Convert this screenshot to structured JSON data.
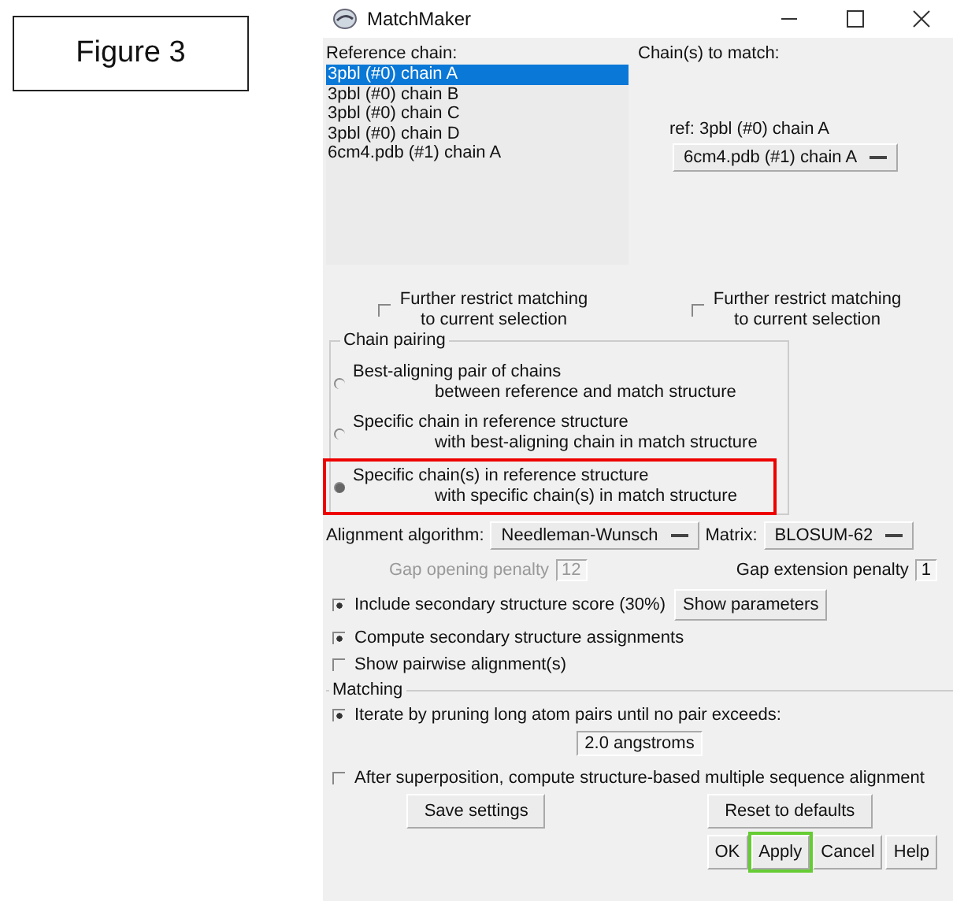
{
  "figure_label": "Figure 3",
  "window": {
    "title": "MatchMaker"
  },
  "reference_chain": {
    "label": "Reference chain:",
    "items": [
      {
        "text": "3pbl (#0) chain A",
        "selected": true
      },
      {
        "text": "3pbl (#0) chain B",
        "selected": false
      },
      {
        "text": "3pbl (#0) chain C",
        "selected": false
      },
      {
        "text": "3pbl (#0) chain D",
        "selected": false
      },
      {
        "text": "6cm4.pdb (#1) chain A",
        "selected": false
      }
    ]
  },
  "chains_to_match": {
    "label": "Chain(s) to match:",
    "ref_label": "ref: 3pbl (#0) chain A",
    "menu_value": "6cm4.pdb (#1) chain A"
  },
  "restrict": [
    {
      "lines": [
        "Further restrict matching",
        "to current selection"
      ],
      "checked": false
    },
    {
      "lines": [
        "Further restrict matching",
        "to current selection"
      ],
      "checked": false
    }
  ],
  "chain_pairing": {
    "title": "Chain pairing",
    "options": [
      {
        "lines": [
          "Best-aligning pair of chains",
          "between reference and match structure"
        ],
        "selected": false,
        "highlighted": false
      },
      {
        "lines": [
          "Specific chain in reference structure",
          "with best-aligning chain in match structure"
        ],
        "selected": false,
        "highlighted": false
      },
      {
        "lines": [
          "Specific chain(s) in reference structure",
          "with specific chain(s) in match structure"
        ],
        "selected": true,
        "highlighted": true
      }
    ]
  },
  "alignment": {
    "algorithm_label": "Alignment algorithm:",
    "algorithm": "Needleman-Wunsch",
    "matrix_label": "Matrix:",
    "matrix": "BLOSUM-62",
    "gap_opening_label": "Gap opening penalty",
    "gap_opening": "12",
    "gap_opening_disabled": true,
    "gap_extension_label": "Gap extension penalty",
    "gap_extension": "1"
  },
  "secondary": {
    "label": "Include secondary structure score (30%)",
    "checked": true,
    "button": "Show parameters"
  },
  "options": [
    {
      "label": "Compute secondary structure assignments",
      "checked": true
    },
    {
      "label": "Show pairwise alignment(s)",
      "checked": false
    }
  ],
  "matching": {
    "title": "Matching",
    "iterate": {
      "label": "Iterate by pruning long atom pairs until no pair exceeds:",
      "checked": true
    },
    "cutoff": "2.0 angstroms"
  },
  "after": {
    "label": "After superposition, compute structure-based multiple sequence alignment",
    "checked": false
  },
  "settings_buttons": [
    "Save settings",
    "Reset to defaults"
  ],
  "dialog_buttons": [
    {
      "label": "OK",
      "highlighted": false
    },
    {
      "label": "Apply",
      "highlighted": true
    },
    {
      "label": "Cancel",
      "highlighted": false
    },
    {
      "label": "Help",
      "highlighted": false
    }
  ]
}
